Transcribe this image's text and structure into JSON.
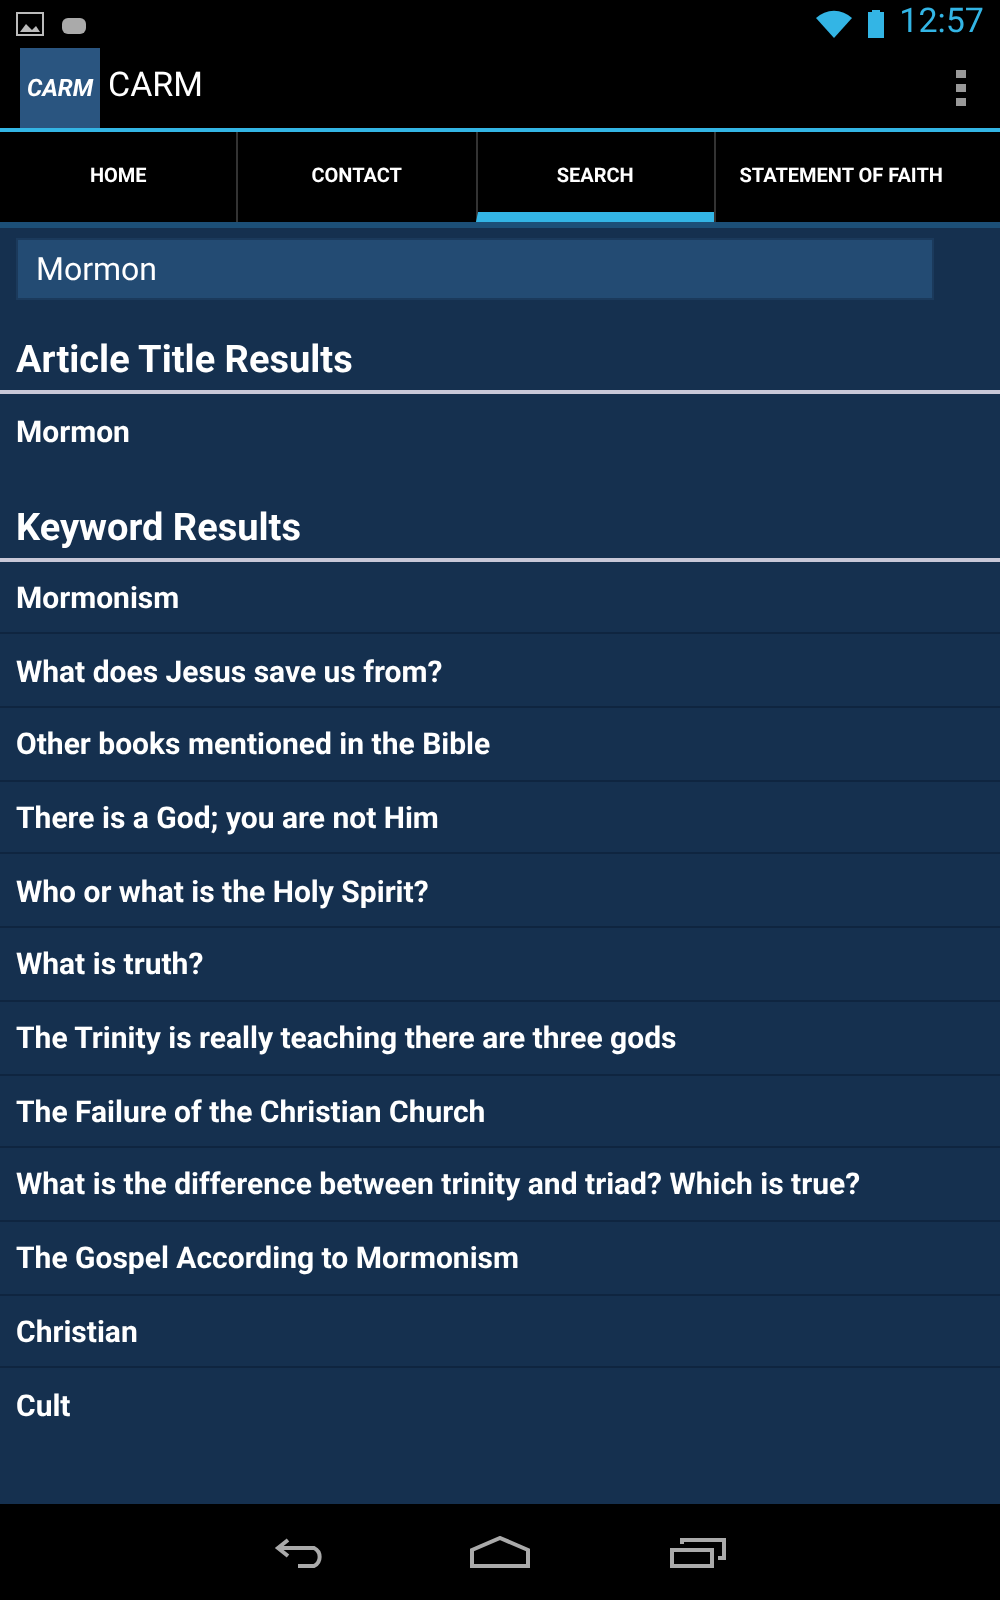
{
  "status_bar": {
    "time": "12:57"
  },
  "app_bar": {
    "title": "CARM",
    "logo": "CARM"
  },
  "tabs": [
    {
      "label": "HOME",
      "selected": false
    },
    {
      "label": "CONTACT",
      "selected": false
    },
    {
      "label": "SEARCH",
      "selected": true
    },
    {
      "label": "STATEMENT OF FAITH",
      "selected": false
    }
  ],
  "search": {
    "value": "Mormon"
  },
  "sections": [
    {
      "heading": "Article Title Results",
      "items": [
        "Mormon"
      ]
    },
    {
      "heading": "Keyword Results",
      "items": [
        "Mormonism",
        "What does Jesus save us from?",
        "Other books mentioned in the Bible",
        "There is a God; you are not Him",
        "Who or what is the Holy Spirit?",
        "What is truth?",
        "The Trinity is really teaching there are three gods",
        "The Failure of the Christian Church",
        "What is the difference between trinity and triad? Which is true?",
        "The Gospel According to Mormonism",
        "Christian",
        "Cult"
      ]
    }
  ]
}
